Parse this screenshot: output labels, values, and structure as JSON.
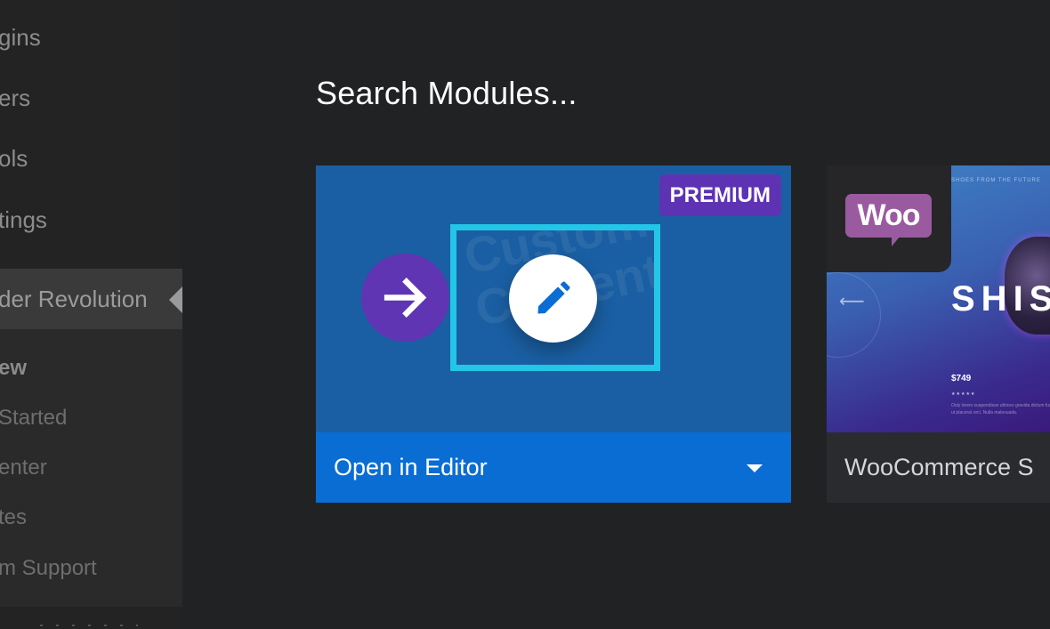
{
  "sidebar": {
    "items": [
      {
        "label": "Plugins",
        "visible_text": "gins"
      },
      {
        "label": "Users",
        "visible_text": "ers"
      },
      {
        "label": "Tools",
        "visible_text": "ols"
      },
      {
        "label": "Settings",
        "visible_text": "tings"
      }
    ],
    "active_item": {
      "label": "Slider Revolution",
      "visible_text": "der Revolution"
    },
    "submenu": [
      {
        "label": "Overview",
        "visible_text": "ew",
        "current": true
      },
      {
        "label": "Getting Started",
        "visible_text": " Started"
      },
      {
        "label": "Help Center",
        "visible_text": "enter"
      },
      {
        "label": "Updates",
        "visible_text": "tes"
      },
      {
        "label": "Premium Support",
        "visible_text": "m Support"
      }
    ]
  },
  "main": {
    "title": "Search Modules...",
    "cards": [
      {
        "name": "Custom Content",
        "badge": "PREMIUM",
        "watermark_line1": "Custom",
        "watermark_line2": "Content",
        "action_label": "Open in Editor",
        "icons": [
          "arrow-right-icon",
          "pencil-icon",
          "caret-down-icon"
        ],
        "colors": {
          "thumb": "#1a5fa3",
          "bar": "#0a6dd4",
          "badge": "#5e33b3",
          "frame": "#23c6e6"
        }
      },
      {
        "name": "WooCommerce Slider",
        "title_visible": "WooCommerce S",
        "logo_text": "Woo",
        "hero": {
          "tagline": "SHOES FROM THE FUTURE",
          "headline": "SHOES",
          "headline_visible": "SHIS",
          "price": "$749",
          "stars": "★★★★★",
          "description": "Ooly lorem suspendisse ultrices gravida dictum fusce ut placerat orci. Nulla malesuada."
        }
      }
    ]
  }
}
